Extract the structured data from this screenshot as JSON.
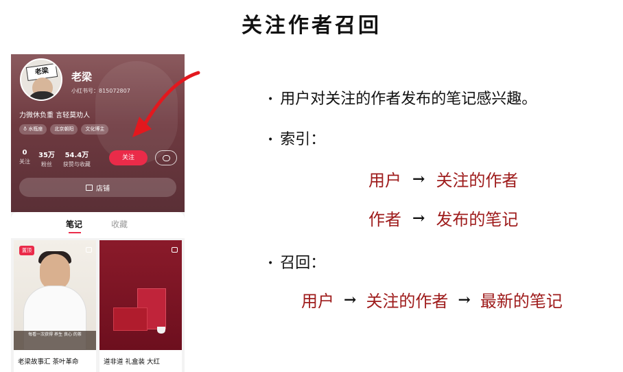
{
  "slide": {
    "title": "关注作者召回",
    "bullets": [
      "用户对关注的作者发布的笔记感兴趣。",
      "索引：",
      "召回："
    ],
    "index_rows": [
      {
        "from": "用户",
        "to": "关注的作者"
      },
      {
        "from": "作者",
        "to": "发布的笔记"
      }
    ],
    "recall_chain": [
      "用户",
      "关注的作者",
      "最新的笔记"
    ],
    "accent_color": "#9e1b1b"
  },
  "phone": {
    "profile": {
      "avatar_text": "老梁",
      "nickname": "老梁",
      "rednote_id": "小红书号：815072807",
      "bio": "力微休负重 言轻莫劝人",
      "tags": [
        "♁ 水瓶座",
        "北京朝阳",
        "文化博主"
      ],
      "stats": [
        {
          "num": "0",
          "label": "关注"
        },
        {
          "num": "35万",
          "label": "粉丝"
        },
        {
          "num": "54.4万",
          "label": "获赞与收藏"
        }
      ],
      "follow_label": "关注",
      "shop_label": "店铺"
    },
    "tabs": {
      "notes": "笔记",
      "collect": "收藏"
    },
    "cards": [
      {
        "badge": "置顶",
        "image_caption": "每看一次获得  养生  良心  的茶",
        "title": "老梁故事汇 茶叶革命"
      },
      {
        "title": "道非道 礼盒装 大红"
      }
    ],
    "colors": {
      "brand": "#ea2b49",
      "header": "#6e3a40"
    }
  }
}
